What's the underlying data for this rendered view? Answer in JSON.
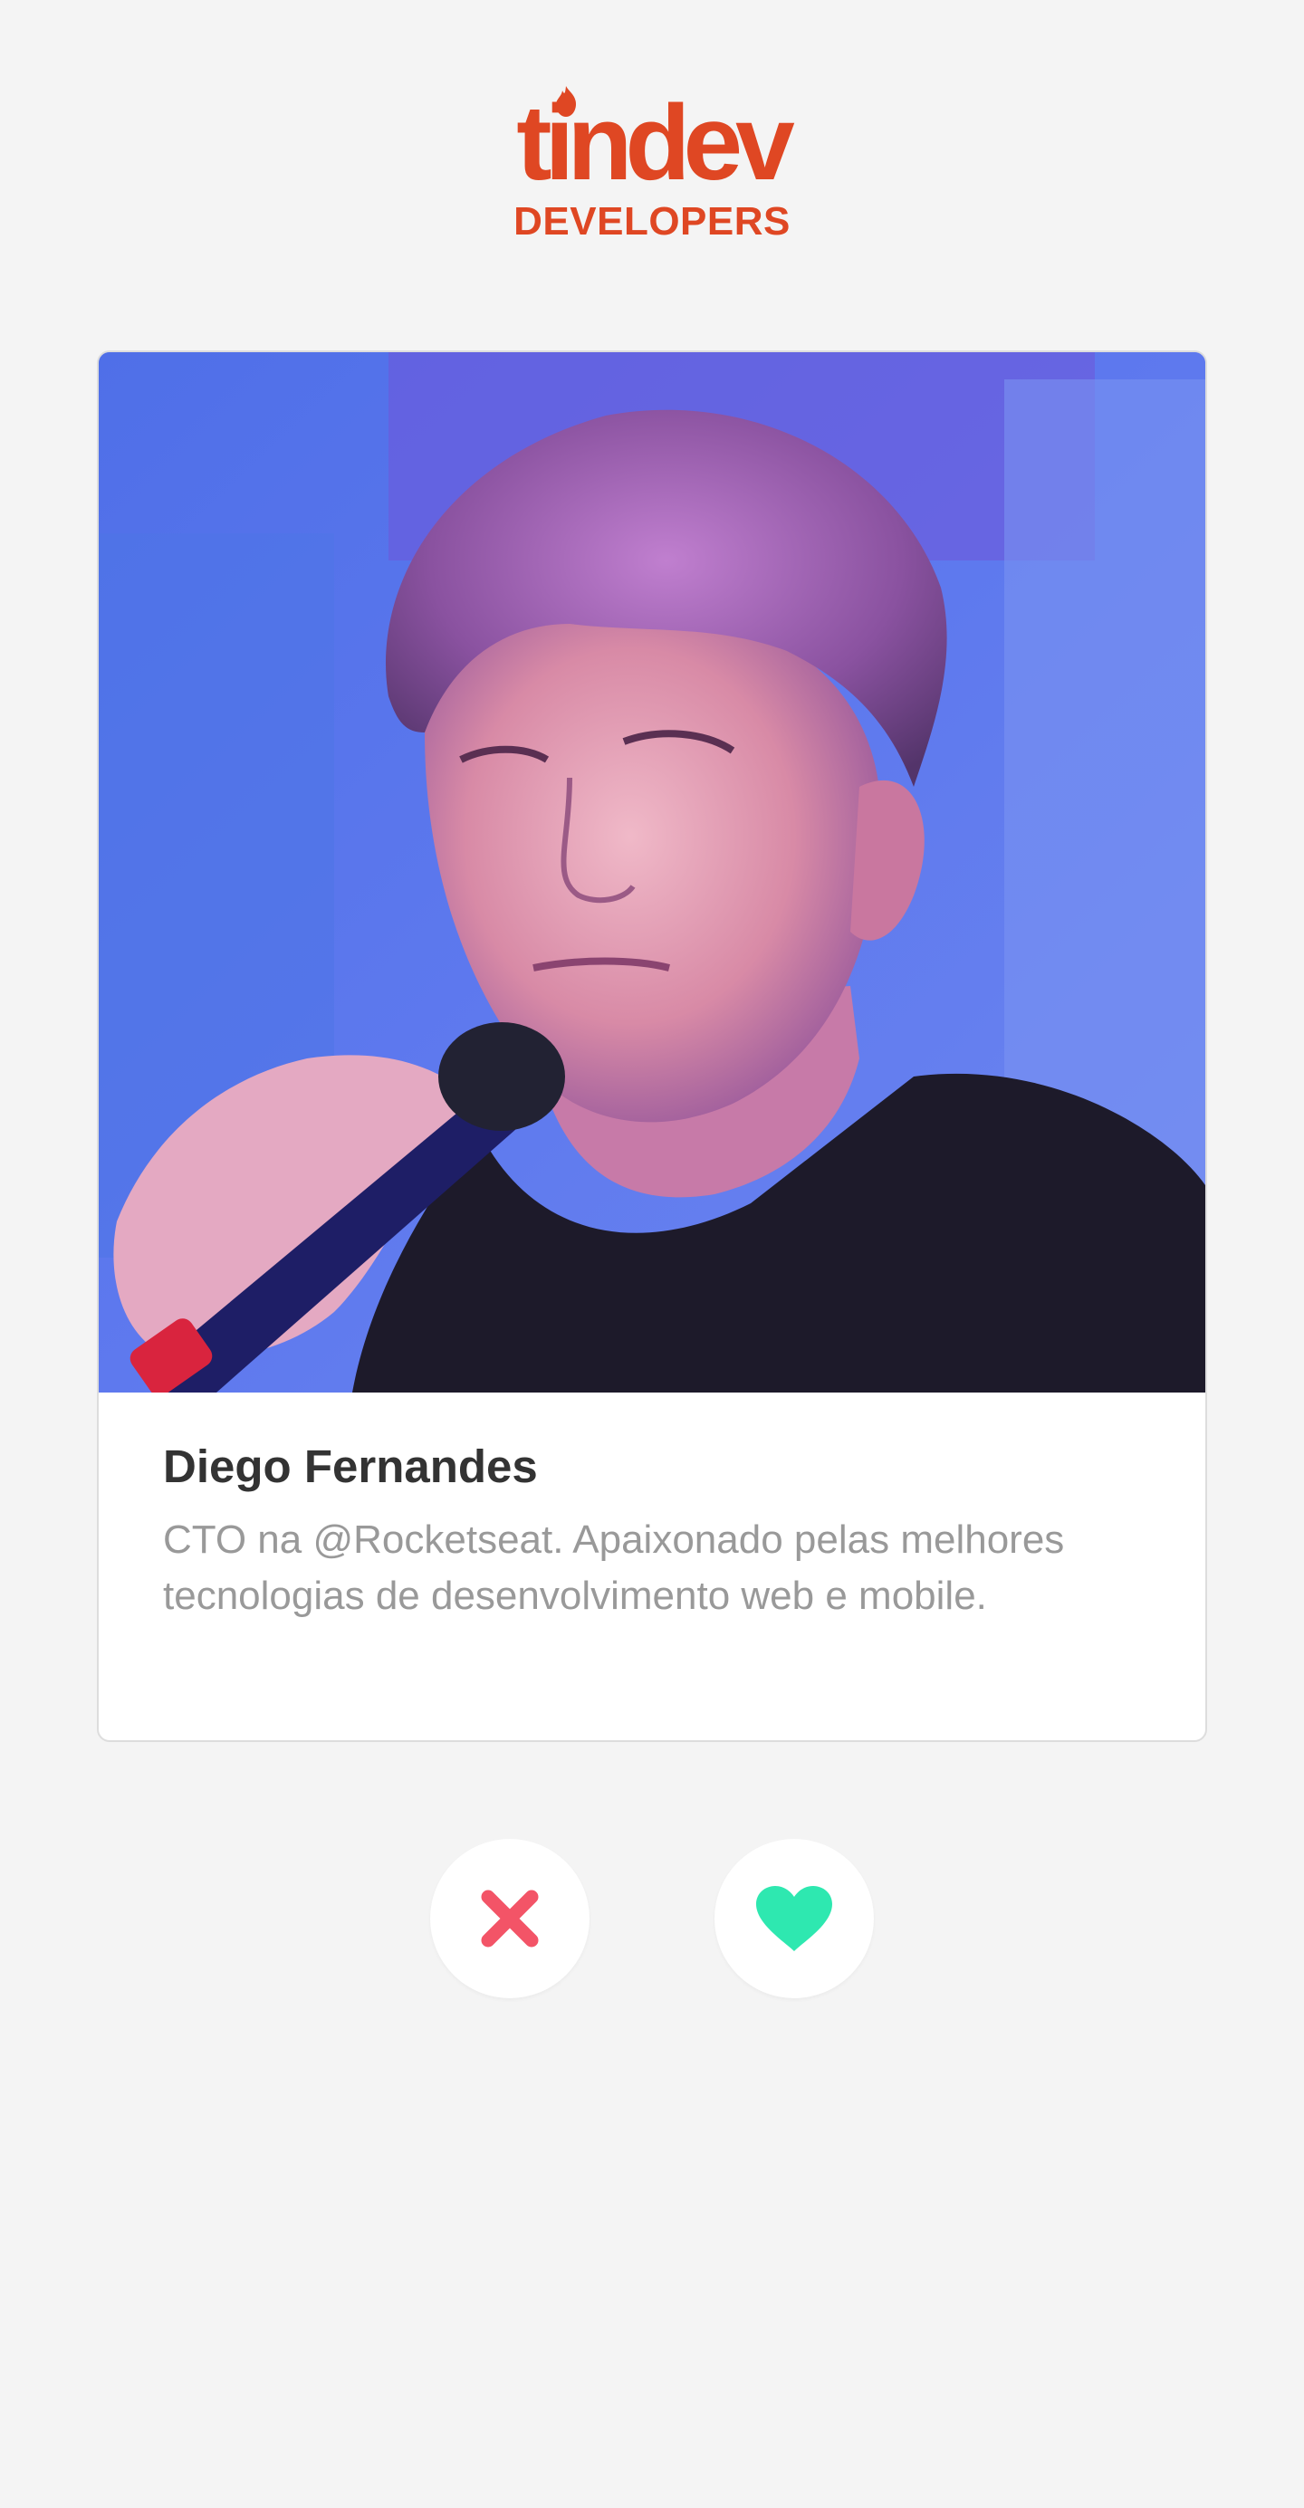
{
  "header": {
    "logo_word": "tindev",
    "logo_sub": "DEVELOPERS"
  },
  "profile": {
    "name": "Diego Fernandes",
    "bio": "CTO na @Rocketseat. Apaixonado pelas melhores tecnologias de desenvolvimento web e mobile."
  },
  "actions": {
    "dislike_icon": "close-icon",
    "like_icon": "heart-icon"
  },
  "colors": {
    "brand": "#df4723",
    "dislike": "#f35467",
    "like": "#2ee8b0",
    "name_text": "#333333",
    "bio_text": "#999999",
    "background": "#f4f4f4"
  }
}
